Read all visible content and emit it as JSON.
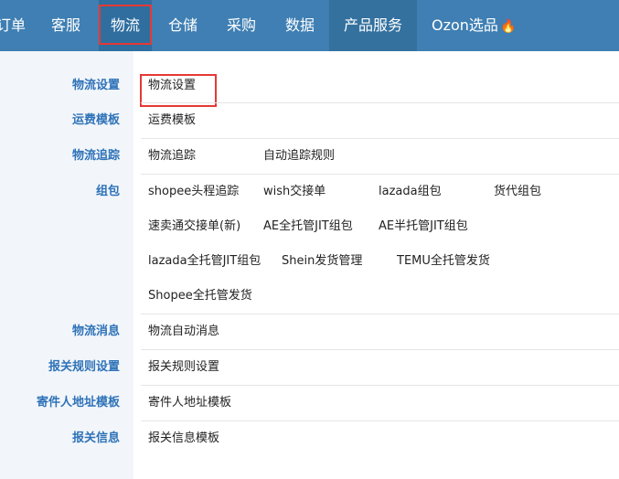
{
  "nav": {
    "items": [
      "订单",
      "客服",
      "物流",
      "仓储",
      "采购",
      "数据",
      "产品服务",
      "Ozon选品"
    ],
    "hot_icon": "fire-icon"
  },
  "menu": {
    "sections": [
      {
        "label": "物流设置",
        "links": [
          "物流设置"
        ]
      },
      {
        "label": "运费模板",
        "links": [
          "运费模板"
        ]
      },
      {
        "label": "物流追踪",
        "links": [
          "物流追踪",
          "自动追踪规则"
        ]
      },
      {
        "label": "组包",
        "links": [
          "shopee头程追踪",
          "wish交接单",
          "lazada组包",
          "货代组包",
          "速卖通交接单(新)",
          "AE全托管JIT组包",
          "AE半托管JIT组包",
          "lazada全托管JIT组包",
          "Shein发货管理",
          "TEMU全托管发货",
          "Shopee全托管发货"
        ]
      },
      {
        "label": "物流消息",
        "links": [
          "物流自动消息"
        ]
      },
      {
        "label": "报关规则设置",
        "links": [
          "报关规则设置"
        ]
      },
      {
        "label": "寄件人地址模板",
        "links": [
          "寄件人地址模板"
        ]
      },
      {
        "label": "报关信息",
        "links": [
          "报关信息模板"
        ]
      }
    ]
  },
  "colors": {
    "nav_bg": "#3f7fb3",
    "highlight": "#e53935",
    "label_blue": "#2e72b8"
  }
}
